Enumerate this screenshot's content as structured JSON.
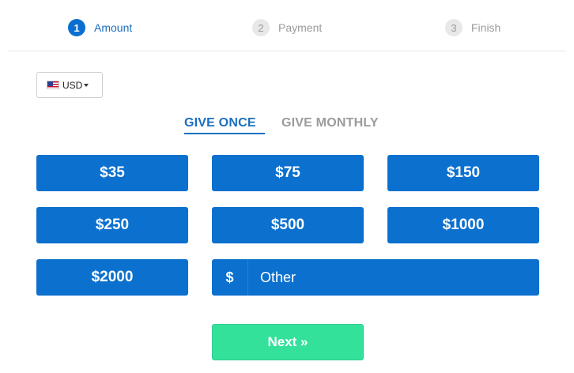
{
  "steps": [
    {
      "number": "1",
      "label": "Amount",
      "state": "active"
    },
    {
      "number": "2",
      "label": "Payment",
      "state": "inactive"
    },
    {
      "number": "3",
      "label": "Finish",
      "state": "inactive"
    }
  ],
  "currency": {
    "code": "USD",
    "flag_icon": "us-flag-icon"
  },
  "frequency_tabs": {
    "once": "GIVE ONCE",
    "monthly": "GIVE MONTHLY",
    "selected": "once"
  },
  "amounts": [
    "$35",
    "$75",
    "$150",
    "$250",
    "$500",
    "$1000",
    "$2000"
  ],
  "other_amount": {
    "symbol": "$",
    "placeholder": "Other",
    "value": ""
  },
  "next_button": {
    "label": "Next »"
  },
  "colors": {
    "primary": "#0b70ce",
    "active_text": "#1b6fbf",
    "muted": "#9b9b9b",
    "next": "#34e19b"
  }
}
